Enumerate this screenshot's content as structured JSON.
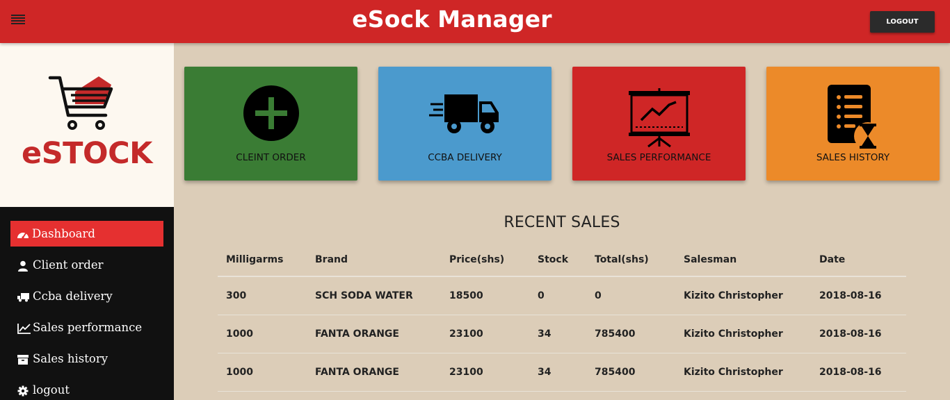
{
  "header": {
    "title": "eSock Manager",
    "logout_label": "LOGOUT"
  },
  "logo": {
    "text": "eSTOCK"
  },
  "sidebar": {
    "items": [
      {
        "label": "Dashboard",
        "icon": "dashboard-icon",
        "active": true
      },
      {
        "label": "Client order",
        "icon": "user-icon",
        "active": false
      },
      {
        "label": "Ccba delivery",
        "icon": "truck-icon",
        "active": false
      },
      {
        "label": "Sales performance",
        "icon": "line-chart-icon",
        "active": false
      },
      {
        "label": "Sales history",
        "icon": "archive-icon",
        "active": false
      },
      {
        "label": "logout",
        "icon": "gear-icon",
        "active": false
      }
    ]
  },
  "cards": [
    {
      "label": "CLEINT ORDER",
      "icon": "plus-circle-icon",
      "color": "#3a7c34"
    },
    {
      "label": "CCBA DELIVERY",
      "icon": "delivery-truck-icon",
      "color": "#4b9acd"
    },
    {
      "label": "SALES PERFORMANCE",
      "icon": "presentation-chart-icon",
      "color": "#cf2626"
    },
    {
      "label": "SALES HISTORY",
      "icon": "list-hourglass-icon",
      "color": "#ec8a29"
    }
  ],
  "recent_sales": {
    "title": "RECENT SALES",
    "columns": [
      "Milligarms",
      "Brand",
      "Price(shs)",
      "Stock",
      "Total(shs)",
      "Salesman",
      "Date"
    ],
    "rows": [
      [
        "300",
        "SCH SODA WATER",
        "18500",
        "0",
        "0",
        "Kizito Christopher",
        "2018-08-16"
      ],
      [
        "1000",
        "FANTA ORANGE",
        "23100",
        "34",
        "785400",
        "Kizito Christopher",
        "2018-08-16"
      ],
      [
        "1000",
        "FANTA ORANGE",
        "23100",
        "34",
        "785400",
        "Kizito Christopher",
        "2018-08-16"
      ]
    ]
  },
  "colors": {
    "header_red": "#cf2626",
    "active_nav": "#e53030",
    "page_bg": "#dccdb8",
    "sidebar_bg": "#111111"
  }
}
